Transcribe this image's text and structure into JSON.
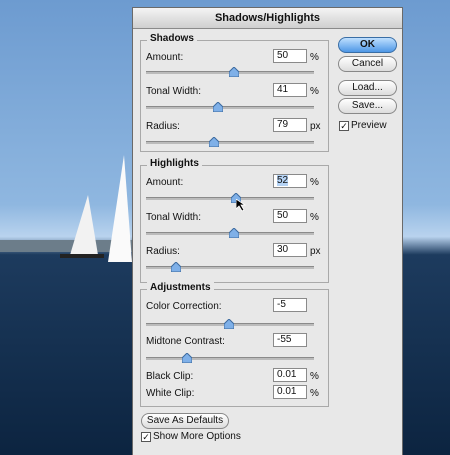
{
  "dialog": {
    "title": "Shadows/Highlights"
  },
  "shadows": {
    "title": "Shadows",
    "amount": {
      "label": "Amount:",
      "value": "50",
      "unit": "%",
      "level": 0.5
    },
    "tonal": {
      "label": "Tonal Width:",
      "value": "41",
      "unit": "%",
      "level": 0.41
    },
    "radius": {
      "label": "Radius:",
      "value": "79",
      "unit": "px",
      "level": 0.4
    }
  },
  "highlights": {
    "title": "Highlights",
    "amount": {
      "label": "Amount:",
      "value": "52",
      "unit": "%",
      "level": 0.52
    },
    "tonal": {
      "label": "Tonal Width:",
      "value": "50",
      "unit": "%",
      "level": 0.5
    },
    "radius": {
      "label": "Radius:",
      "value": "30",
      "unit": "px",
      "level": 0.15
    }
  },
  "adjustments": {
    "title": "Adjustments",
    "color": {
      "label": "Color Correction:",
      "value": "-5",
      "level": 0.48
    },
    "midtone": {
      "label": "Midtone Contrast:",
      "value": "-55",
      "level": 0.22
    },
    "black": {
      "label": "Black Clip:",
      "value": "0.01",
      "unit": "%"
    },
    "white": {
      "label": "White Clip:",
      "value": "0.01",
      "unit": "%"
    }
  },
  "buttons": {
    "ok": "OK",
    "cancel": "Cancel",
    "load": "Load...",
    "save": "Save...",
    "defaults": "Save As Defaults"
  },
  "preview": {
    "label": "Preview",
    "checked": true
  },
  "more_options": {
    "label": "Show More Options",
    "checked": true
  }
}
